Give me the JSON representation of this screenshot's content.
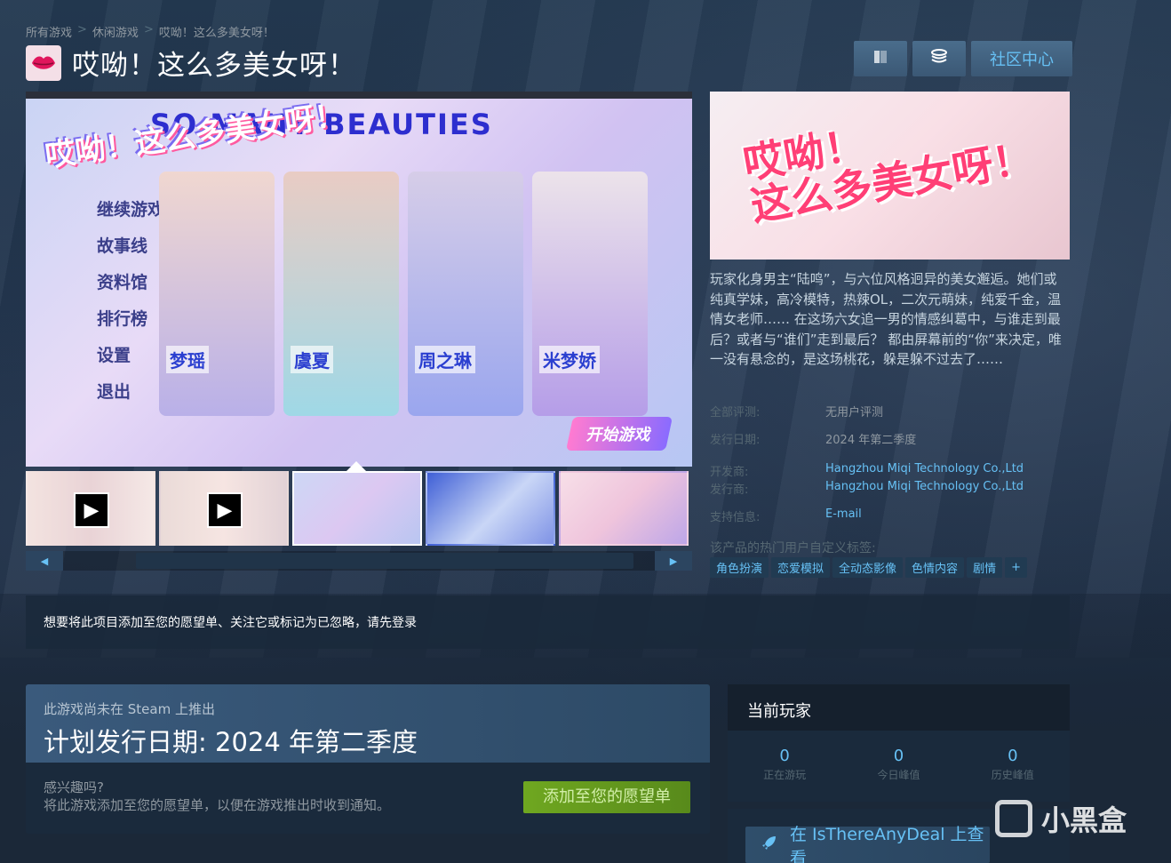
{
  "breadcrumb": [
    "所有游戏",
    "休闲游戏",
    "哎呦！这么多美女呀！"
  ],
  "breadcrumb_sep": ">",
  "game": {
    "title": "哎呦！这么多美女呀！"
  },
  "top_buttons": {
    "community_label": "社区中心",
    "icon1": "book-icon",
    "icon2": "stack-icon"
  },
  "media": {
    "logo_text": "哎呦！这么多美女呀！",
    "logo_sub": "SO MANY BEAUTIES",
    "menu": [
      "继续游戏",
      "故事线",
      "资料馆",
      "排行榜",
      "设置",
      "退出"
    ],
    "cards": [
      "梦瑶",
      "虞夏",
      "周之琳",
      "米梦娇"
    ],
    "start_label": "开始游戏",
    "thumbnails": [
      {
        "type": "video"
      },
      {
        "type": "video"
      },
      {
        "type": "image",
        "selected": true
      },
      {
        "type": "image"
      },
      {
        "type": "image"
      }
    ]
  },
  "capsule": {
    "logo_line1": "哎呦！",
    "logo_line2": "这么多美女呀！"
  },
  "description": "玩家化身男主“陆鸣”，与六位风格迥异的美女邂逅。她们或纯真学妹，高冷模特，热辣OL，二次元萌妹，纯爱千金，温情女老师…… 在这场六女追一男的情感纠葛中，与谁走到最后？或者与“谁们”走到最后？ 都由屏幕前的“你”来决定，唯一没有悬念的，是这场桃花，躲是躲不过去了……",
  "info": {
    "reviews_label": "全部评测:",
    "reviews_value": "无用户评测",
    "release_label": "发行日期:",
    "release_value": "2024 年第二季度",
    "developer_label": "开发商:",
    "developer_value": "Hangzhou Miqi Technology Co.,Ltd",
    "publisher_label": "发行商:",
    "publisher_value": "Hangzhou Miqi Technology Co.,Ltd",
    "support_label": "支持信息:",
    "support_value": "E-mail"
  },
  "tags_title": "该产品的热门用户自定义标签:",
  "tags": [
    "角色扮演",
    "恋爱模拟",
    "全动态影像",
    "色情内容",
    "剧情",
    "+"
  ],
  "login_bar": {
    "text": "想要将此项目添加至您的愿望单、关注它或标记为已忽略，请先",
    "link": "登录"
  },
  "release_box": {
    "note": "此游戏尚未在 Steam 上推出",
    "date": "计划发行日期: 2024 年第二季度",
    "interest_line1": "感兴趣吗?",
    "interest_line2": "将此游戏添加至您的愿望单，以便在游戏推出时收到通知。",
    "wishlist_button": "添加至您的愿望单"
  },
  "players": {
    "title": "当前玩家",
    "stats": [
      {
        "value": "0",
        "label": "正在游玩"
      },
      {
        "value": "0",
        "label": "今日峰值"
      },
      {
        "value": "0",
        "label": "历史峰值"
      }
    ]
  },
  "itad": {
    "label": "在 IsThereAnyDeal 上查看"
  },
  "watermark": {
    "text": "小黑盒"
  },
  "colors": {
    "accent": "#67c1f5",
    "wishlist": "#6fa720",
    "title": "#ffffff"
  }
}
